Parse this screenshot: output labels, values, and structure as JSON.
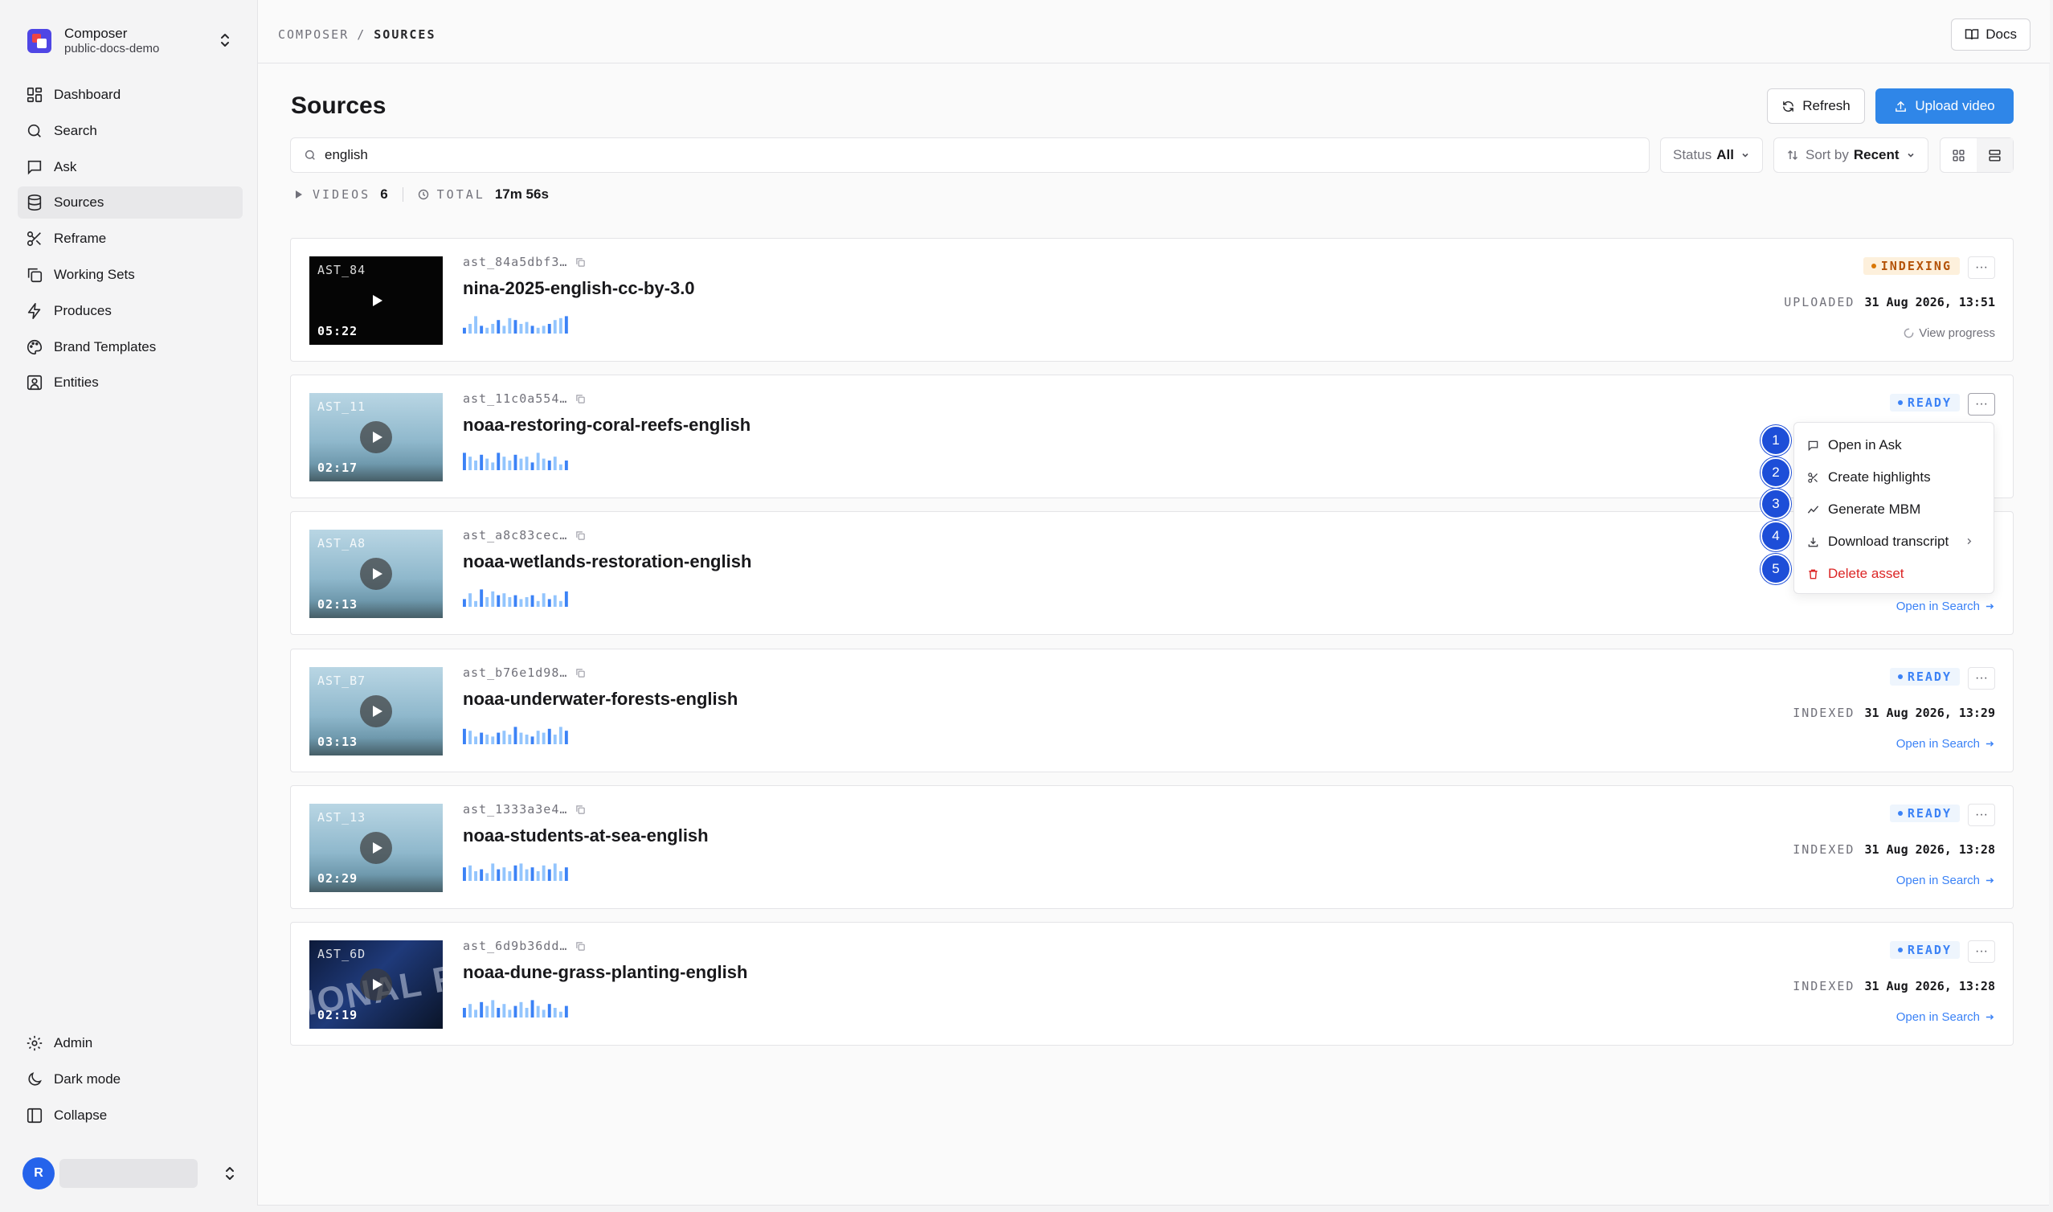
{
  "workspace": {
    "name": "Composer",
    "org": "public-docs-demo"
  },
  "nav": {
    "items": [
      {
        "label": "Dashboard",
        "icon": "dashboard-icon"
      },
      {
        "label": "Search",
        "icon": "search-icon"
      },
      {
        "label": "Ask",
        "icon": "chat-icon"
      },
      {
        "label": "Sources",
        "icon": "database-icon"
      },
      {
        "label": "Reframe",
        "icon": "scissors-icon"
      },
      {
        "label": "Working Sets",
        "icon": "copy-icon"
      },
      {
        "label": "Produces",
        "icon": "bolt-icon"
      },
      {
        "label": "Brand Templates",
        "icon": "palette-icon"
      },
      {
        "label": "Entities",
        "icon": "contact-icon"
      }
    ],
    "active": "Sources",
    "bottom": [
      {
        "label": "Admin",
        "icon": "gear-icon"
      },
      {
        "label": "Dark mode",
        "icon": "moon-icon"
      },
      {
        "label": "Collapse",
        "icon": "panel-icon"
      }
    ]
  },
  "user": {
    "initial": "R"
  },
  "breadcrumb": {
    "root": "COMPOSER",
    "sep": "/",
    "current": "SOURCES"
  },
  "header": {
    "docs_label": "Docs"
  },
  "page": {
    "title": "Sources",
    "refresh_label": "Refresh",
    "upload_label": "Upload video"
  },
  "search": {
    "value": "english",
    "placeholder": ""
  },
  "filters": {
    "status_label": "Status",
    "status_value": "All",
    "sort_label": "Sort by",
    "sort_value": "Recent"
  },
  "stats": {
    "videos_label": "VIDEOS",
    "videos_value": "6",
    "total_label": "TOTAL",
    "total_value": "17m 56s"
  },
  "assets": [
    {
      "thumb_code": "AST_84",
      "duration": "05:22",
      "id": "ast_84a5dbf3…",
      "name": "nina-2025-english-cc-by-3.0",
      "status": "INDEXING",
      "meta_label": "UPLOADED",
      "meta_value": "31 Aug 2026, 13:51",
      "link": "View progress",
      "wave": [
        0.3,
        0.5,
        0.9,
        0.4,
        0.3,
        0.5,
        0.7,
        0.4,
        0.8,
        0.7,
        0.5,
        0.6,
        0.4,
        0.3,
        0.4,
        0.5,
        0.7,
        0.8,
        0.9
      ]
    },
    {
      "thumb_code": "AST_11",
      "duration": "02:17",
      "id": "ast_11c0a554…",
      "name": "noaa-restoring-coral-reefs-english",
      "status": "READY",
      "meta_label": "",
      "meta_value": "",
      "link": "",
      "wave": [
        0.9,
        0.7,
        0.5,
        0.8,
        0.6,
        0.4,
        0.9,
        0.7,
        0.5,
        0.8,
        0.6,
        0.7,
        0.4,
        0.9,
        0.6,
        0.5,
        0.7,
        0.3,
        0.5
      ]
    },
    {
      "thumb_code": "AST_A8",
      "duration": "02:13",
      "id": "ast_a8c83cec…",
      "name": "noaa-wetlands-restoration-english",
      "status": "READY",
      "meta_label": "",
      "meta_value": "",
      "link": "Open in Search",
      "wave": [
        0.4,
        0.7,
        0.3,
        0.9,
        0.5,
        0.8,
        0.6,
        0.7,
        0.5,
        0.6,
        0.4,
        0.5,
        0.6,
        0.3,
        0.7,
        0.4,
        0.6,
        0.3,
        0.8
      ]
    },
    {
      "thumb_code": "AST_B7",
      "duration": "03:13",
      "id": "ast_b76e1d98…",
      "name": "noaa-underwater-forests-english",
      "status": "READY",
      "meta_label": "INDEXED",
      "meta_value": "31 Aug 2026, 13:29",
      "link": "Open in Search",
      "wave": [
        0.8,
        0.7,
        0.4,
        0.6,
        0.5,
        0.4,
        0.6,
        0.7,
        0.5,
        0.9,
        0.6,
        0.5,
        0.4,
        0.7,
        0.6,
        0.8,
        0.5,
        0.9,
        0.7
      ]
    },
    {
      "thumb_code": "AST_13",
      "duration": "02:29",
      "id": "ast_1333a3e4…",
      "name": "noaa-students-at-sea-english",
      "status": "READY",
      "meta_label": "INDEXED",
      "meta_value": "31 Aug 2026, 13:28",
      "link": "Open in Search",
      "wave": [
        0.7,
        0.8,
        0.5,
        0.6,
        0.4,
        0.9,
        0.6,
        0.7,
        0.5,
        0.8,
        0.9,
        0.6,
        0.7,
        0.5,
        0.8,
        0.6,
        0.9,
        0.5,
        0.7
      ]
    },
    {
      "thumb_code": "AST_6D",
      "duration": "02:19",
      "id": "ast_6d9b36dd…",
      "name": "noaa-dune-grass-planting-english",
      "status": "READY",
      "meta_label": "INDEXED",
      "meta_value": "31 Aug 2026, 13:28",
      "link": "Open in Search",
      "wave": [
        0.5,
        0.7,
        0.4,
        0.8,
        0.6,
        0.9,
        0.5,
        0.7,
        0.4,
        0.6,
        0.8,
        0.5,
        0.9,
        0.6,
        0.4,
        0.7,
        0.5,
        0.3,
        0.6
      ]
    }
  ],
  "thumb_overlay": "IONAL RIUM",
  "menu": {
    "items": [
      {
        "num": "1",
        "label": "Open in Ask",
        "icon": "chat-icon"
      },
      {
        "num": "2",
        "label": "Create highlights",
        "icon": "scissors-icon"
      },
      {
        "num": "3",
        "label": "Generate MBM",
        "icon": "trend-icon"
      },
      {
        "num": "4",
        "label": "Download transcript",
        "icon": "download-icon"
      },
      {
        "num": "5",
        "label": "Delete asset",
        "icon": "trash-icon"
      }
    ]
  },
  "colors": {
    "accent": "#2f86e8",
    "ready": "#3b82f6",
    "indexing": "#b45309",
    "danger": "#dc2626",
    "marker": "#1d4ed8"
  }
}
